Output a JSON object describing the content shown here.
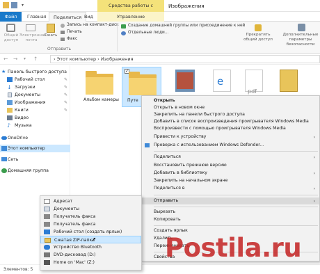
{
  "window": {
    "title": "Изображения",
    "context_tab_group": "Средства работы с рисунками"
  },
  "tabs": [
    {
      "label": "Файл"
    },
    {
      "label": "Главная"
    },
    {
      "label": "Поделиться"
    },
    {
      "label": "Вид"
    },
    {
      "label": "Управление"
    }
  ],
  "ribbon": {
    "share_button": "Общий доступ",
    "email_button": "Электронная почта",
    "zip_button": "Сжать",
    "burn_disc": "Запись на компакт-диск",
    "print": "Печать",
    "fax": "Факс",
    "send_group": "Отправить",
    "homegroup": "Создание домашней группы или присоединение к ней",
    "specific_users": "Отдельные люди...",
    "stop_sharing": "Прекратить общий доступ",
    "advanced_security": "Дополнительные параметры безопасности",
    "advanced_security_2": "Дополнительные настройки безопасно"
  },
  "address": {
    "path": "› Этот компьютер › Изображения"
  },
  "sidebar": {
    "items": [
      {
        "label": "Панель быстрого доступа",
        "icon": "star-icon"
      },
      {
        "label": "Рабочий стол",
        "icon": "desktop-icon",
        "pinned": true
      },
      {
        "label": "Загрузки",
        "icon": "download-icon",
        "pinned": true
      },
      {
        "label": "Документы",
        "icon": "documents-icon",
        "pinned": true
      },
      {
        "label": "Изображения",
        "icon": "pictures-icon",
        "pinned": true
      },
      {
        "label": "Книги",
        "icon": "folder-icon",
        "pinned": true
      },
      {
        "label": "Видео",
        "icon": "video-icon"
      },
      {
        "label": "Музыка",
        "icon": "music-icon"
      },
      {
        "label": "OneDrive",
        "icon": "cloud-icon"
      },
      {
        "label": "Этот компьютер",
        "icon": "computer-icon"
      },
      {
        "label": "Сеть",
        "icon": "network-icon"
      },
      {
        "label": "Домашняя группа",
        "icon": "homegroup-icon"
      }
    ]
  },
  "content": {
    "items": [
      {
        "label": "Альбом камеры"
      },
      {
        "label": "Путе"
      }
    ]
  },
  "status": {
    "text": "Элементов: 5"
  },
  "context_menu": {
    "items": [
      "Открыть",
      "Открыть в новом окне",
      "Закрепить на панели быстрого доступа",
      "Добавить в список воспроизведения проигрывателя Windows Media",
      "Воспроизвести с помощью проигрывателя Windows Media",
      "Привести к устройству",
      "Проверка с использованием Windows Defender...",
      "Поделиться",
      "Восстановить прежнюю версию",
      "Добавить в библиотеку",
      "Закрепить на начальном экране",
      "Поделиться в",
      "Отправить",
      "Вырезать",
      "Копировать",
      "Создать ярлык",
      "Удалить",
      "Переименовать",
      "Свойства"
    ]
  },
  "send_to": {
    "items": [
      "Адресат",
      "Документы",
      "Получатель факса",
      "Получатель факса",
      "Рабочий стол (создать ярлык)",
      "Сжатая ZIP-папка",
      "Устройство Bluetooth",
      "DVD-дисковод (D:)",
      "Home on 'Mac' (Z:)"
    ]
  },
  "watermark": {
    "text": "Postila.ru"
  },
  "colors": {
    "file_tab": "#1979ca",
    "context_tab": "#f4e27a",
    "selection": "#cce8ff",
    "folder": "#f6d371",
    "watermark": "#c42828"
  }
}
